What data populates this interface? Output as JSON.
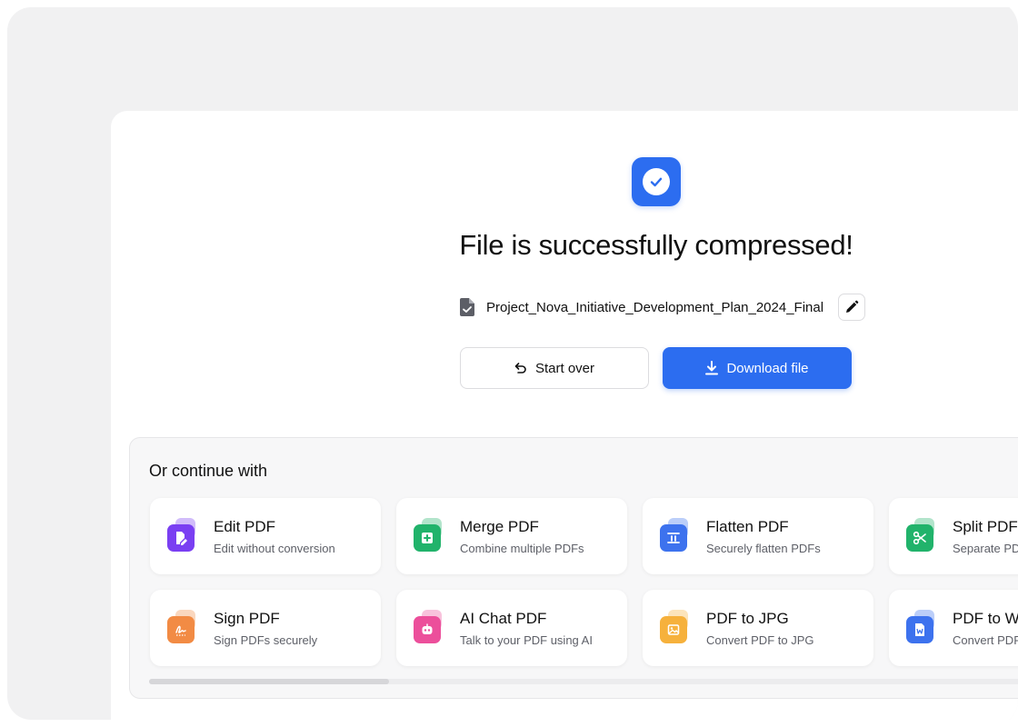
{
  "success": {
    "title": "File is successfully compressed!",
    "icon": "check-circle-icon",
    "accent": "#2c6df0"
  },
  "file": {
    "name": "Project_Nova_Initiative_Development_Plan_2024_Final",
    "icon": "file-check-icon",
    "edit_icon": "pencil-icon"
  },
  "actions": {
    "start_over": "Start over",
    "download": "Download file"
  },
  "continue": {
    "title": "Or continue with",
    "tools": [
      {
        "name": "Edit PDF",
        "desc": "Edit without conversion",
        "icon": "edit-pdf-icon",
        "color": "#7a3ff2"
      },
      {
        "name": "Merge PDF",
        "desc": "Combine multiple PDFs",
        "icon": "merge-pdf-icon",
        "color": "#21b36b"
      },
      {
        "name": "Flatten PDF",
        "desc": "Securely flatten PDFs",
        "icon": "flatten-pdf-icon",
        "color": "#3d72ee"
      },
      {
        "name": "Split PDF",
        "desc": "Separate PDF pages",
        "icon": "scissors-icon",
        "color": "#21b36b"
      },
      {
        "name": "Sign PDF",
        "desc": "Sign PDFs securely",
        "icon": "signature-icon",
        "color": "#f28b44"
      },
      {
        "name": "AI Chat PDF",
        "desc": "Talk to your PDF using AI",
        "icon": "robot-icon",
        "color": "#ec4f9b"
      },
      {
        "name": "PDF to JPG",
        "desc": "Convert PDF to JPG",
        "icon": "image-icon",
        "color": "#f6b13c"
      },
      {
        "name": "PDF to Word",
        "desc": "Convert PDF to Word",
        "icon": "word-icon",
        "color": "#3d72ee"
      }
    ]
  }
}
